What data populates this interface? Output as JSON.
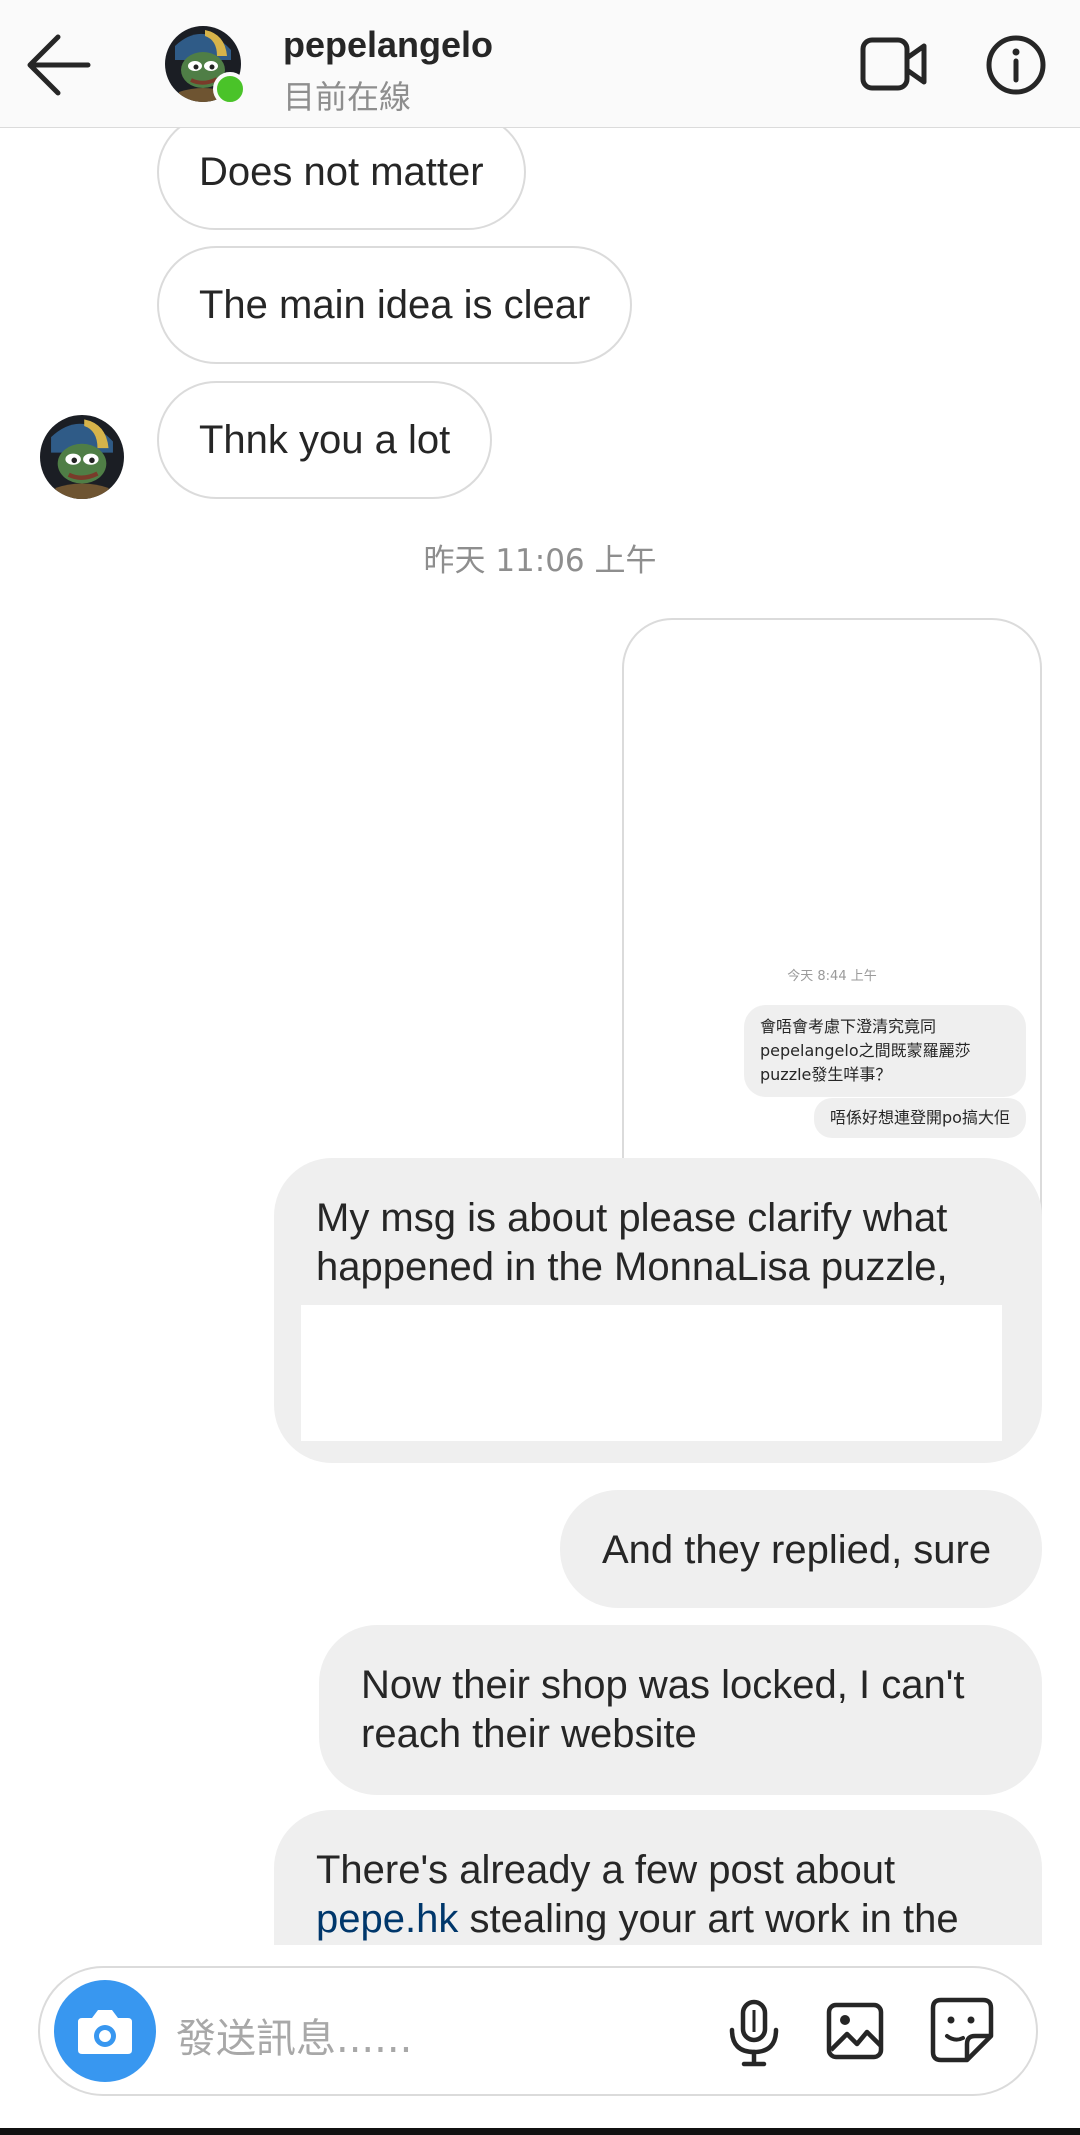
{
  "header": {
    "username": "pepelangelo",
    "status": "目前在線"
  },
  "messages": {
    "incoming": [
      "Does not matter",
      "The main idea is clear",
      "Thnk you a lot"
    ],
    "timestamp": "昨天 11:06 上午",
    "shared_screenshot": {
      "timestamp": "今天 8:44 上午",
      "bubble1": "會唔會考慮下澄清究竟同pepelangelo之間既蒙羅麗莎puzzle發生咩事？",
      "bubble2": "唔係好想連登開po搞大佢"
    },
    "outgoing": {
      "msg1": "My msg is about please clarify what happened in the MonnaLisa puzzle,",
      "msg2": "And they replied, sure",
      "msg3": "Now their shop was locked, I can't reach their website",
      "msg4_prefix": "There's already a few post about ",
      "msg4_link": "pepe.hk",
      "msg4_suffix": " stealing your art work in the"
    }
  },
  "composer": {
    "placeholder": "發送訊息......"
  },
  "icons": {
    "back": "back-arrow-icon",
    "video": "video-call-icon",
    "info": "info-icon",
    "camera": "camera-icon",
    "mic": "microphone-icon",
    "gallery": "gallery-icon",
    "sticker": "sticker-icon"
  },
  "colors": {
    "online": "#4ac329",
    "camera_button": "#3897f0",
    "link": "#00376b",
    "outgoing_bubble": "#efefef"
  }
}
